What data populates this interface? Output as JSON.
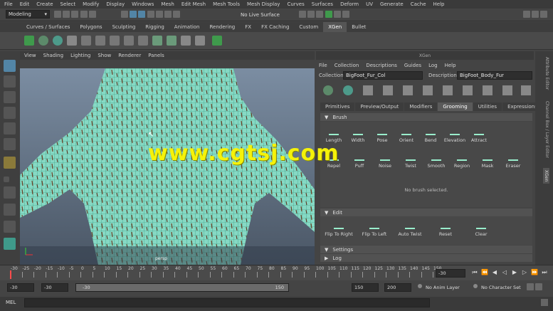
{
  "menubar": [
    "File",
    "Edit",
    "Create",
    "Select",
    "Modify",
    "Display",
    "Windows",
    "Mesh",
    "Edit Mesh",
    "Mesh Tools",
    "Mesh Display",
    "Curves",
    "Surfaces",
    "Deform",
    "UV",
    "Generate",
    "Cache",
    "Help"
  ],
  "status": {
    "mode": "Modeling",
    "live_surface": "No Live Surface"
  },
  "shelf_tabs": [
    "Curves / Surfaces",
    "Polygons",
    "Sculpting",
    "Rigging",
    "Animation",
    "Rendering",
    "FX",
    "FX Caching",
    "Custom",
    "XGen",
    "Bullet"
  ],
  "shelf_active": "XGen",
  "viewport_menu": [
    "View",
    "Shading",
    "Lighting",
    "Show",
    "Renderer",
    "Panels"
  ],
  "viewport": {
    "camera_label": "persp"
  },
  "xgen": {
    "title": "XGen",
    "menu": [
      "File",
      "Collection",
      "Descriptions",
      "Guides",
      "Log",
      "Help"
    ],
    "collection_label": "Collection",
    "collection_value": "BigFoot_Fur_Col",
    "description_label": "Description",
    "description_value": "BigFoot_Body_Fur",
    "tabs": [
      "Primitives",
      "Preview/Output",
      "Modifiers",
      "Grooming",
      "Utilities",
      "Expressions"
    ],
    "active_tab": "Grooming",
    "brush_section": "Brush",
    "brushes_row1": [
      "Length",
      "Width",
      "Pose",
      "Orient",
      "Bend",
      "Elevation",
      "Attract"
    ],
    "brushes_row2": [
      "Repel",
      "Puff",
      "Noise",
      "Twist",
      "Smooth",
      "Region",
      "Mask",
      "Eraser"
    ],
    "no_brush": "No brush selected.",
    "edit_section": "Edit",
    "edit_items": [
      "Flip To Right",
      "Flip To Left",
      "Auto Twist",
      "Reset",
      "Clear"
    ],
    "settings_section": "Settings",
    "log_section": "Log"
  },
  "right_tabs": [
    "Attribute Editor",
    "Channel Box / Layer Editor",
    "XGen"
  ],
  "timeline": {
    "ticks": [
      "-30",
      "-25",
      "-20",
      "-15",
      "-10",
      "-5",
      "0",
      "5",
      "10",
      "15",
      "20",
      "25",
      "30",
      "35",
      "40",
      "45",
      "50",
      "55",
      "60",
      "65",
      "70",
      "75",
      "80",
      "85",
      "90",
      "95",
      "100",
      "105",
      "110",
      "115",
      "120",
      "125",
      "130",
      "135",
      "140",
      "145",
      "150"
    ],
    "current_frame": "-30"
  },
  "range": {
    "start": "-30",
    "anim_start": "-30",
    "slider_start": "-30",
    "slider_end": "150",
    "anim_end": "150",
    "end": "200",
    "anim_layer": "No Anim Layer",
    "character_set": "No Character Set"
  },
  "cmdline_label": "MEL",
  "watermark": "www.cgtsj.com",
  "colors": {
    "accent": "#5285a6",
    "mesh": "#7fd6c2",
    "fur": "#7a4a2a",
    "watermark": "#f5f20a"
  }
}
